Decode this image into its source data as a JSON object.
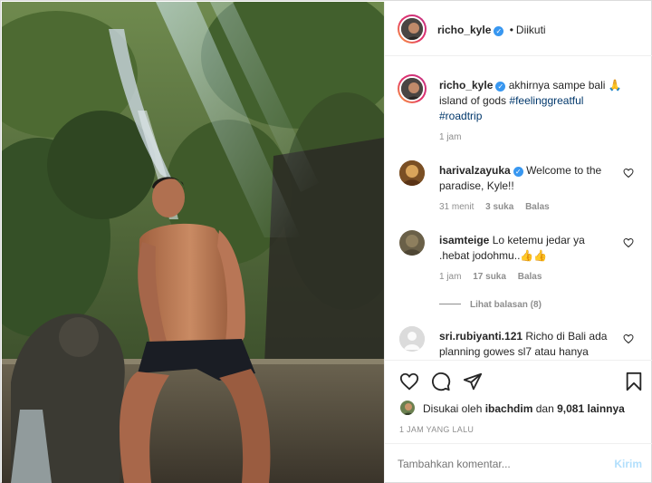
{
  "post": {
    "author": "richo_kyle",
    "follow_status": "Diikuti",
    "caption": {
      "text": "akhirnya sampe bali 🙏",
      "line2": "island of gods",
      "hashtag1": "#feelinggreatful",
      "hashtag2": "#roadtrip",
      "time": "1 jam"
    }
  },
  "comments": [
    {
      "user": "harivalzayuka",
      "verified": true,
      "text1": "Welcome to the",
      "text2": "paradise, Kyle!!",
      "time": "31 menit",
      "likes": "3 suka",
      "reply": "Balas"
    },
    {
      "user": "isamteige",
      "text1": "Lo ketemu jedar ya",
      "text2": ".hebat jodohmu..👍👍",
      "time": "1 jam",
      "likes": "17 suka",
      "reply": "Balas",
      "view_replies": "Lihat balasan (8)"
    },
    {
      "user": "sri.rubiyanti.121",
      "text1": "Richo di Bali ada",
      "text2": "planning gowes sl7 atau hanya"
    }
  ],
  "likes": {
    "prefix": "Disukai oleh",
    "user": "ibachdim",
    "conj": "dan",
    "count": "9,081 lainnya"
  },
  "timestamp": "1 JAM YANG LALU",
  "comment_box": {
    "placeholder": "Tambahkan komentar...",
    "post_label": "Kirim"
  },
  "colors": {
    "link": "#00376b",
    "verified": "#3897f0",
    "post_button_disabled": "#b2dffc"
  }
}
